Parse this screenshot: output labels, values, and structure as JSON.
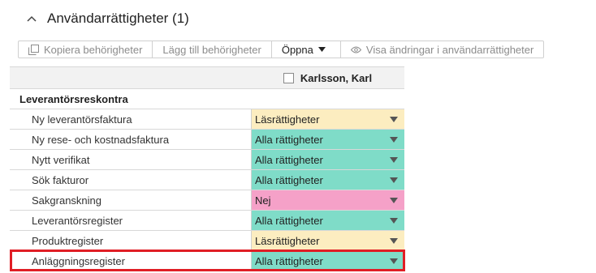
{
  "header": {
    "title": "Användarrättigheter (1)"
  },
  "toolbar": {
    "copy_label": "Kopiera behörigheter",
    "add_label": "Lägg till behörigheter",
    "open_label": "Öppna",
    "show_changes_label": "Visa ändringar i användarrättigheter"
  },
  "grid": {
    "user": "Karlsson, Karl",
    "section": "Leverantörsreskontra",
    "rows": [
      {
        "label": "Ny leverantörsfaktura",
        "value": "Läsrättigheter",
        "color": "#fcedc0"
      },
      {
        "label": "Ny rese- och kostnadsfaktura",
        "value": "Alla rättigheter",
        "color": "#7fdcc8"
      },
      {
        "label": "Nytt verifikat",
        "value": "Alla rättigheter",
        "color": "#7fdcc8"
      },
      {
        "label": "Sök fakturor",
        "value": "Alla rättigheter",
        "color": "#7fdcc8"
      },
      {
        "label": "Sakgranskning",
        "value": "Nej",
        "color": "#f5a1c8"
      },
      {
        "label": "Leverantörsregister",
        "value": "Alla rättigheter",
        "color": "#7fdcc8"
      },
      {
        "label": "Produktregister",
        "value": "Läsrättigheter",
        "color": "#fcedc0"
      },
      {
        "label": "Anläggningsregister",
        "value": "Alla rättigheter",
        "color": "#7fdcc8"
      }
    ]
  },
  "highlight": {
    "color": "#e01e25"
  }
}
